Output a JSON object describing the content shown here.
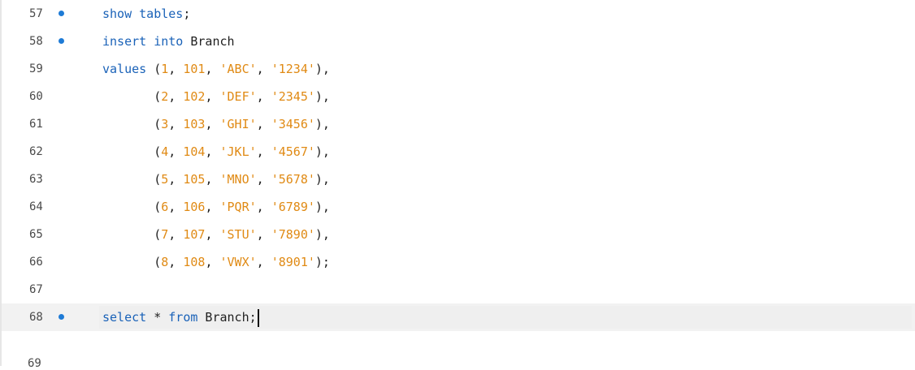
{
  "editor": {
    "lines": [
      {
        "num": "57",
        "dot": true,
        "tokens": [
          [
            "kw",
            "show tables"
          ],
          [
            "plain",
            ";"
          ]
        ]
      },
      {
        "num": "58",
        "dot": true,
        "tokens": [
          [
            "kw",
            "insert into"
          ],
          [
            "plain",
            " Branch"
          ]
        ]
      },
      {
        "num": "59",
        "dot": false,
        "tokens": [
          [
            "kw",
            "values"
          ],
          [
            "plain",
            " ("
          ],
          [
            "num",
            "1"
          ],
          [
            "plain",
            ", "
          ],
          [
            "num",
            "101"
          ],
          [
            "plain",
            ", "
          ],
          [
            "str",
            "'ABC'"
          ],
          [
            "plain",
            ", "
          ],
          [
            "str",
            "'1234'"
          ],
          [
            "plain",
            "),"
          ]
        ]
      },
      {
        "num": "60",
        "dot": false,
        "tokens": [
          [
            "plain",
            "       ("
          ],
          [
            "num",
            "2"
          ],
          [
            "plain",
            ", "
          ],
          [
            "num",
            "102"
          ],
          [
            "plain",
            ", "
          ],
          [
            "str",
            "'DEF'"
          ],
          [
            "plain",
            ", "
          ],
          [
            "str",
            "'2345'"
          ],
          [
            "plain",
            "),"
          ]
        ]
      },
      {
        "num": "61",
        "dot": false,
        "tokens": [
          [
            "plain",
            "       ("
          ],
          [
            "num",
            "3"
          ],
          [
            "plain",
            ", "
          ],
          [
            "num",
            "103"
          ],
          [
            "plain",
            ", "
          ],
          [
            "str",
            "'GHI'"
          ],
          [
            "plain",
            ", "
          ],
          [
            "str",
            "'3456'"
          ],
          [
            "plain",
            "),"
          ]
        ]
      },
      {
        "num": "62",
        "dot": false,
        "tokens": [
          [
            "plain",
            "       ("
          ],
          [
            "num",
            "4"
          ],
          [
            "plain",
            ", "
          ],
          [
            "num",
            "104"
          ],
          [
            "plain",
            ", "
          ],
          [
            "str",
            "'JKL'"
          ],
          [
            "plain",
            ", "
          ],
          [
            "str",
            "'4567'"
          ],
          [
            "plain",
            "),"
          ]
        ]
      },
      {
        "num": "63",
        "dot": false,
        "tokens": [
          [
            "plain",
            "       ("
          ],
          [
            "num",
            "5"
          ],
          [
            "plain",
            ", "
          ],
          [
            "num",
            "105"
          ],
          [
            "plain",
            ", "
          ],
          [
            "str",
            "'MNO'"
          ],
          [
            "plain",
            ", "
          ],
          [
            "str",
            "'5678'"
          ],
          [
            "plain",
            "),"
          ]
        ]
      },
      {
        "num": "64",
        "dot": false,
        "tokens": [
          [
            "plain",
            "       ("
          ],
          [
            "num",
            "6"
          ],
          [
            "plain",
            ", "
          ],
          [
            "num",
            "106"
          ],
          [
            "plain",
            ", "
          ],
          [
            "str",
            "'PQR'"
          ],
          [
            "plain",
            ", "
          ],
          [
            "str",
            "'6789'"
          ],
          [
            "plain",
            "),"
          ]
        ]
      },
      {
        "num": "65",
        "dot": false,
        "tokens": [
          [
            "plain",
            "       ("
          ],
          [
            "num",
            "7"
          ],
          [
            "plain",
            ", "
          ],
          [
            "num",
            "107"
          ],
          [
            "plain",
            ", "
          ],
          [
            "str",
            "'STU'"
          ],
          [
            "plain",
            ", "
          ],
          [
            "str",
            "'7890'"
          ],
          [
            "plain",
            "),"
          ]
        ]
      },
      {
        "num": "66",
        "dot": false,
        "tokens": [
          [
            "plain",
            "       ("
          ],
          [
            "num",
            "8"
          ],
          [
            "plain",
            ", "
          ],
          [
            "num",
            "108"
          ],
          [
            "plain",
            ", "
          ],
          [
            "str",
            "'VWX'"
          ],
          [
            "plain",
            ", "
          ],
          [
            "str",
            "'8901'"
          ],
          [
            "plain",
            ");"
          ]
        ]
      },
      {
        "num": "67",
        "dot": false,
        "tokens": []
      },
      {
        "num": "68",
        "dot": true,
        "current": true,
        "tokens": [
          [
            "kw",
            "select"
          ],
          [
            "plain",
            " * "
          ],
          [
            "kw",
            "from"
          ],
          [
            "plain",
            " Branch;"
          ]
        ]
      }
    ],
    "partial_line_num": "69"
  },
  "colors": {
    "keyword": "#1a62b8",
    "literal": "#e08a14",
    "plain": "#1f1f1f",
    "gutter": "#4a4a4a",
    "dot": "#1e7bd6",
    "current_line": "#f2f2f2"
  }
}
